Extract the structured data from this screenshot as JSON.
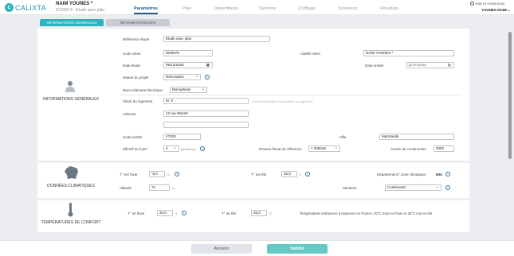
{
  "app": {
    "logo": "CALIXTA",
    "project_name": "NAIM YOUNES *",
    "project_sub": "EC09274 - Etude avec plan"
  },
  "nav": [
    "Paramètres",
    "Plan",
    "Déperditions",
    "Système",
    "Chiffrage",
    "Scénarios",
    "Résultats"
  ],
  "header": {
    "help": "Aide et ressources",
    "user": "YOUNES NAIM"
  },
  "tabs": {
    "general": "INFORMATIONS GENERALES",
    "dpe": "INFORMATIONS DPE"
  },
  "sections": {
    "general": {
      "title": "INFORMATIONS GÉNÉRALES",
      "ref_label": "Référence étude",
      "ref_value": "Etude avec plan",
      "code_client_label": "Code client",
      "code_client_value": "W00978",
      "libelle_label": "Libellé client",
      "libelle_value": "NAIM YOUNES *",
      "date_etude_label": "Date étude",
      "date_etude_value": "05/12/2025",
      "date_entree_label": "Date entrée",
      "date_entree_value": "jj/mm/aaaa",
      "nature_label": "Nature du projet",
      "nature_value": "Rénovation",
      "raccord_label": "Raccordement électrique",
      "raccord_value": "Monophasé",
      "client_logement_label": "Client du logement",
      "client_logement_value": "M. X",
      "client_hint": "Client propriétaire ou locataire du logement",
      "adresse_label": "Adresse",
      "adresse_value": "12 rue Mozart",
      "adresse2_value": "",
      "cp_label": "Code postal",
      "cp_value": "47200",
      "ville_label": "Ville",
      "ville_value": "Marmande",
      "effectif_label": "Effectif du foyer",
      "effectif_value": "4",
      "effectif_unit": "personnes",
      "revenu_label": "Revenu fiscal de référence",
      "revenu_value": "< 63844€",
      "annee_label": "Année de construction",
      "annee_value": "2002"
    },
    "climat": {
      "title": "DONNÉES CLIMATIQUES",
      "t_hiver_label": "T° ext hiver",
      "t_hiver_value": "-5,0",
      "t_unit": "°C",
      "t_ete_label": "T° ext été",
      "t_ete_value": "36,0",
      "dept_label": "Département / zone climatique :",
      "dept_value": "H2c",
      "altitude_label": "Altitude",
      "altitude_value": "72",
      "altitude_unit": "m",
      "situation_label": "Situation",
      "situation_value": "Continental"
    },
    "confort": {
      "title": "TEMPÉRATURES DE CONFORT",
      "t_int_hiver_label": "T° int hiver",
      "t_int_hiver_value": "20,0",
      "t_int_ete_label": "T° int été",
      "t_int_ete_value": "26,0",
      "unit": "°C",
      "note": "Températures intérieures à respecter en France: 20°C maxi en hiver et 26°C min en été"
    }
  },
  "footer": {
    "cancel": "Annuler",
    "validate": "Valider"
  },
  "colors": {
    "accent": "#2bb3c0",
    "nav_active": "#1f5a7a",
    "validate": "#66c9c6"
  }
}
